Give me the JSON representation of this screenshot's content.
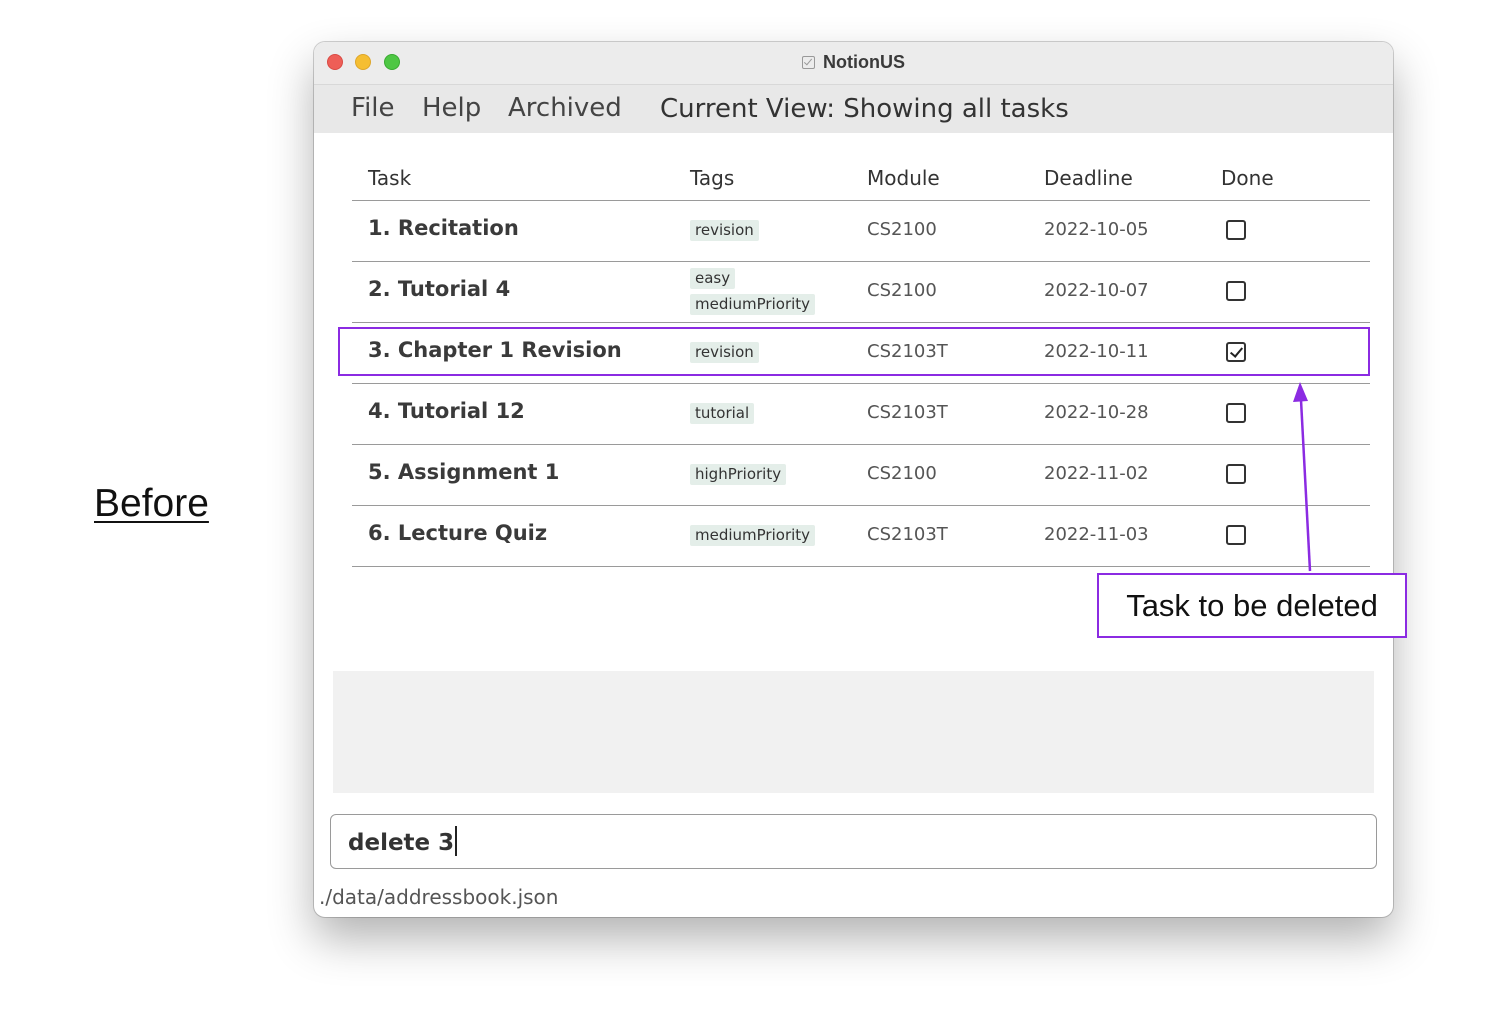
{
  "annotation": {
    "before_label": "Before",
    "callout_text": "Task to be deleted",
    "accent_color": "#8b2be2"
  },
  "window": {
    "title": "NotionUS",
    "title_icon": "checkbox-icon"
  },
  "menubar": {
    "items": [
      {
        "label": "File"
      },
      {
        "label": "Help"
      },
      {
        "label": "Archived"
      }
    ],
    "current_view": "Current View: Showing all tasks"
  },
  "table": {
    "headers": {
      "task": "Task",
      "tags": "Tags",
      "module": "Module",
      "deadline": "Deadline",
      "done": "Done"
    },
    "rows": [
      {
        "task": "1. Recitation",
        "tags": [
          "revision"
        ],
        "module": "CS2100",
        "deadline": "2022-10-05",
        "done": false
      },
      {
        "task": "2. Tutorial 4",
        "tags": [
          "easy",
          "mediumPriority"
        ],
        "module": "CS2100",
        "deadline": "2022-10-07",
        "done": false
      },
      {
        "task": "3. Chapter 1 Revision",
        "tags": [
          "revision"
        ],
        "module": "CS2103T",
        "deadline": "2022-10-11",
        "done": true
      },
      {
        "task": "4. Tutorial 12",
        "tags": [
          "tutorial"
        ],
        "module": "CS2103T",
        "deadline": "2022-10-28",
        "done": false
      },
      {
        "task": "5. Assignment 1",
        "tags": [
          "highPriority"
        ],
        "module": "CS2100",
        "deadline": "2022-11-02",
        "done": false
      },
      {
        "task": "6. Lecture Quiz",
        "tags": [
          "mediumPriority"
        ],
        "module": "CS2103T",
        "deadline": "2022-11-03",
        "done": false
      }
    ]
  },
  "result_display": {
    "text": ""
  },
  "command_box": {
    "value": "delete 3"
  },
  "status_bar": {
    "path": "./data/addressbook.json"
  }
}
